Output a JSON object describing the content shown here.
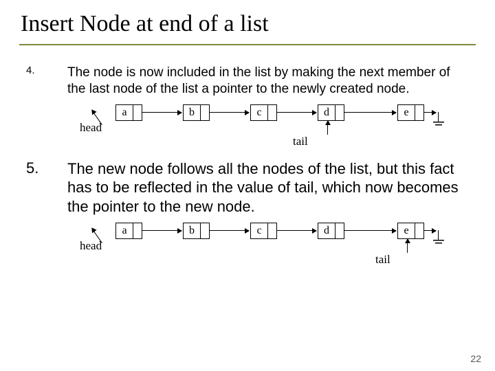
{
  "title": "Insert Node at end of a list",
  "bullets": {
    "b4": {
      "num": "4.",
      "text": "The node is now included in the list by making the next member of the last node of the list a pointer to the newly created node."
    },
    "b5": {
      "num": "5.",
      "text": "The new node follows all the nodes of the list, but this fact has to be reflected in the value of tail, which now becomes the pointer to the new node."
    }
  },
  "labels": {
    "head": "head",
    "tail": "tail"
  },
  "nodes": {
    "n0": "a",
    "n1": "b",
    "n2": "c",
    "n3": "d",
    "n4": "e"
  },
  "page_number": "22"
}
